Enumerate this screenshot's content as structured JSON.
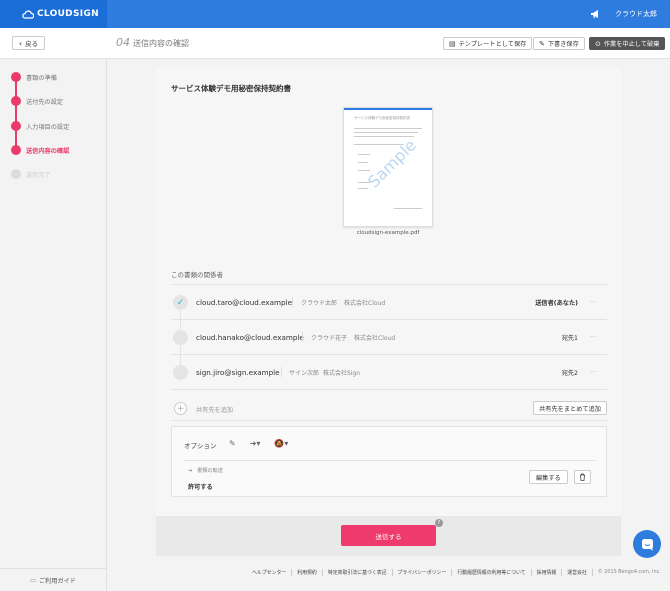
{
  "header": {
    "logo_text": "CLOUDSIGN",
    "user_name": "クラウド太郎",
    "accent_color": "#2e7cde"
  },
  "subheader": {
    "back_label": "戻る",
    "step_number": "04",
    "step_title": "送信内容の確認",
    "template_save_label": "テンプレートとして保存",
    "draft_save_label": "下書き保存",
    "stop_save_label": "作業を中止して破棄"
  },
  "sidebar": {
    "steps": [
      {
        "label": "書類の準備",
        "state": "done"
      },
      {
        "label": "送付先の設定",
        "state": "done"
      },
      {
        "label": "入力項目の設定",
        "state": "done"
      },
      {
        "label": "送信内容の確認",
        "state": "current"
      },
      {
        "label": "送信完了",
        "state": "pending"
      }
    ],
    "guide_label": "ご利用ガイド"
  },
  "document": {
    "title": "サービス体験デモ用秘密保持契約書",
    "thumbnail_watermark": "Sample",
    "thumbnail_heading": "サービス体験デモ用秘密保持契約書",
    "filename": "cloudsign-example.pdf"
  },
  "participants": {
    "heading": "この書類の関係者",
    "rows": [
      {
        "email": "cloud.taro@cloud.example",
        "name": "クラウド太郎",
        "company": "株式会社Cloud",
        "role": "送信者(あなた)",
        "checked": true
      },
      {
        "email": "cloud.hanako@cloud.example",
        "name": "クラウド花子",
        "company": "株式会社Cloud",
        "role": "宛先1",
        "checked": false
      },
      {
        "email": "sign.jiro@sign.example",
        "name": "サイン次郎",
        "company": "株式会社Sign",
        "role": "宛先2",
        "checked": false
      }
    ],
    "more_icon": "…",
    "add_label": "共有先を追加",
    "bulk_add_label": "共有先をまとめて追加"
  },
  "options": {
    "label": "オプション",
    "transfer_label": "書類の転送",
    "transfer_value": "許可する",
    "edit_label": "編集する"
  },
  "footer": {
    "send_label": "送信する",
    "help_mark": "?",
    "links": [
      "ヘルプセンター",
      "利用規約",
      "特定商取引法に基づく表記",
      "プライバシーポリシー",
      "行動履歴情報の利用等について",
      "採用情報",
      "運営会社"
    ],
    "copyright": "© 2015 Bengo4.com, Inc."
  },
  "icons": {
    "check": "✓",
    "plus": "+",
    "pencil": "✎",
    "arrow": "➜",
    "trash": "🗑",
    "back_chevron": "‹"
  }
}
